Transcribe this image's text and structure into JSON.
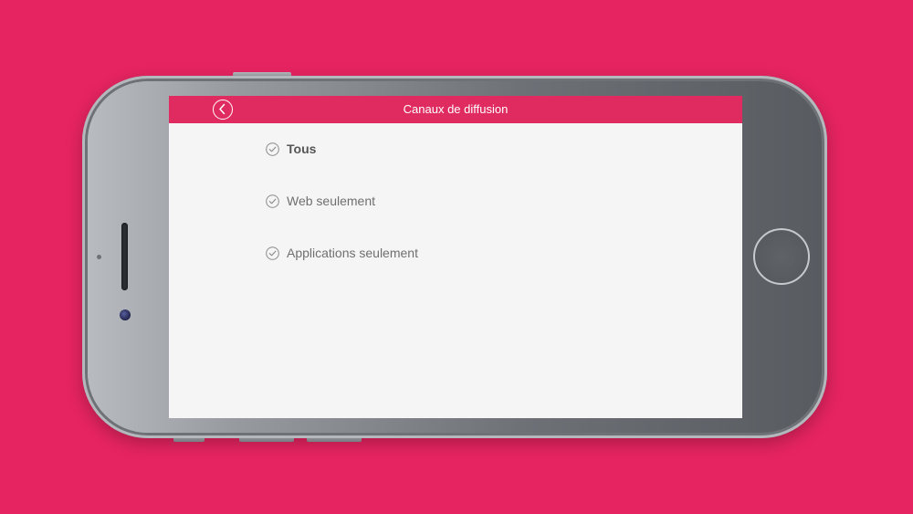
{
  "colors": {
    "background": "#e62461",
    "nav_bar": "#e02b60",
    "screen_bg": "#f5f5f5",
    "text": "#6f6f6f"
  },
  "nav": {
    "title": "Canaux de diffusion",
    "back_icon": "chevron-left-circle-icon"
  },
  "options": [
    {
      "label": "Tous",
      "selected": true,
      "icon": "check-circle-icon"
    },
    {
      "label": "Web seulement",
      "selected": false,
      "icon": "check-circle-icon"
    },
    {
      "label": "Applications seulement",
      "selected": false,
      "icon": "check-circle-icon"
    }
  ]
}
